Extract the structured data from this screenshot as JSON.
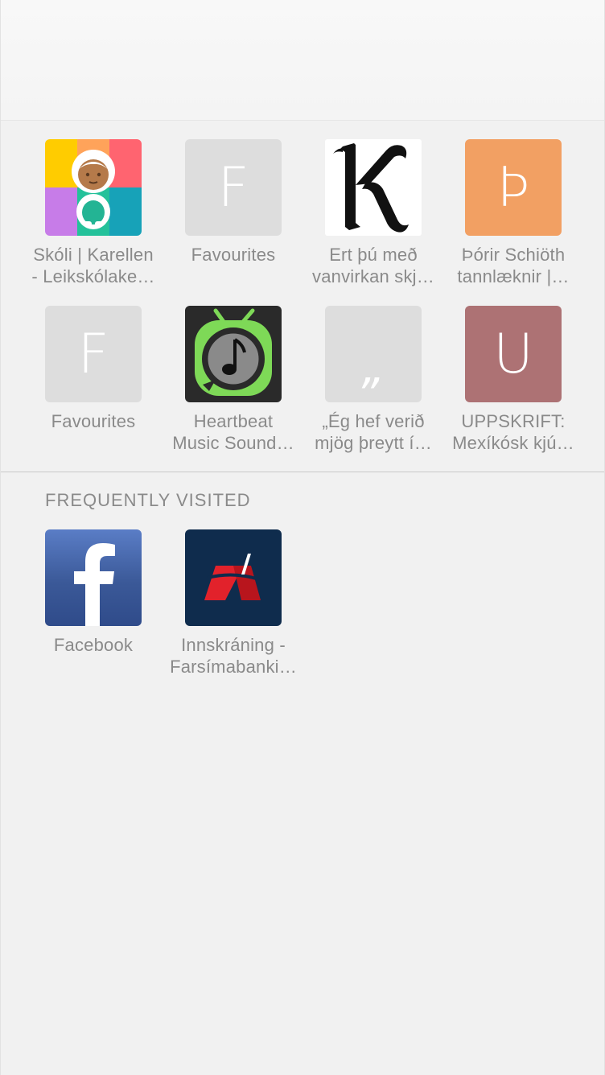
{
  "favourites": [
    {
      "label_line1": "Skóli | Karellen",
      "label_line2": "- Leikskólake…",
      "icon": "karellen-app-icon"
    },
    {
      "label_line1": "Favourites",
      "label_line2": "",
      "icon": "letter-f-icon",
      "letter": "F"
    },
    {
      "label_line1": "Ert þú með",
      "label_line2": "vanvirkan skj…",
      "icon": "gothic-k-icon"
    },
    {
      "label_line1": "Þórir Schiöth",
      "label_line2": "tannlæknir |…",
      "icon": "letter-thorn-icon",
      "letter": "Þ"
    },
    {
      "label_line1": "Favourites",
      "label_line2": "",
      "icon": "letter-f-icon",
      "letter": "F"
    },
    {
      "label_line1": "Heartbeat",
      "label_line2": "Music Sound…",
      "icon": "music-tv-icon"
    },
    {
      "label_line1": "„Ég hef verið",
      "label_line2": "mjög þreytt í…",
      "icon": "quote-mark-icon",
      "letter": "„"
    },
    {
      "label_line1": "UPPSKRIFT:",
      "label_line2": "Mexíkósk kjú…",
      "icon": "letter-u-icon",
      "letter": "U"
    }
  ],
  "frequently_visited": {
    "title": "FREQUENTLY VISITED",
    "items": [
      {
        "label_line1": "Facebook",
        "label_line2": "",
        "icon": "facebook-icon",
        "letter": "f"
      },
      {
        "label_line1": "Innskráning -",
        "label_line2": "Farsímabanki…",
        "icon": "bank-logo-icon"
      }
    ]
  },
  "colors": {
    "background": "#f1f1f1",
    "label": "#8a8a8a",
    "placeholder_tile": "#dddddd",
    "thorn_tile": "#f2a063",
    "u_tile": "#ad7274",
    "facebook_blue": "#3b5998",
    "bank_navy": "#0f2c4d",
    "bank_red": "#e2222b"
  }
}
